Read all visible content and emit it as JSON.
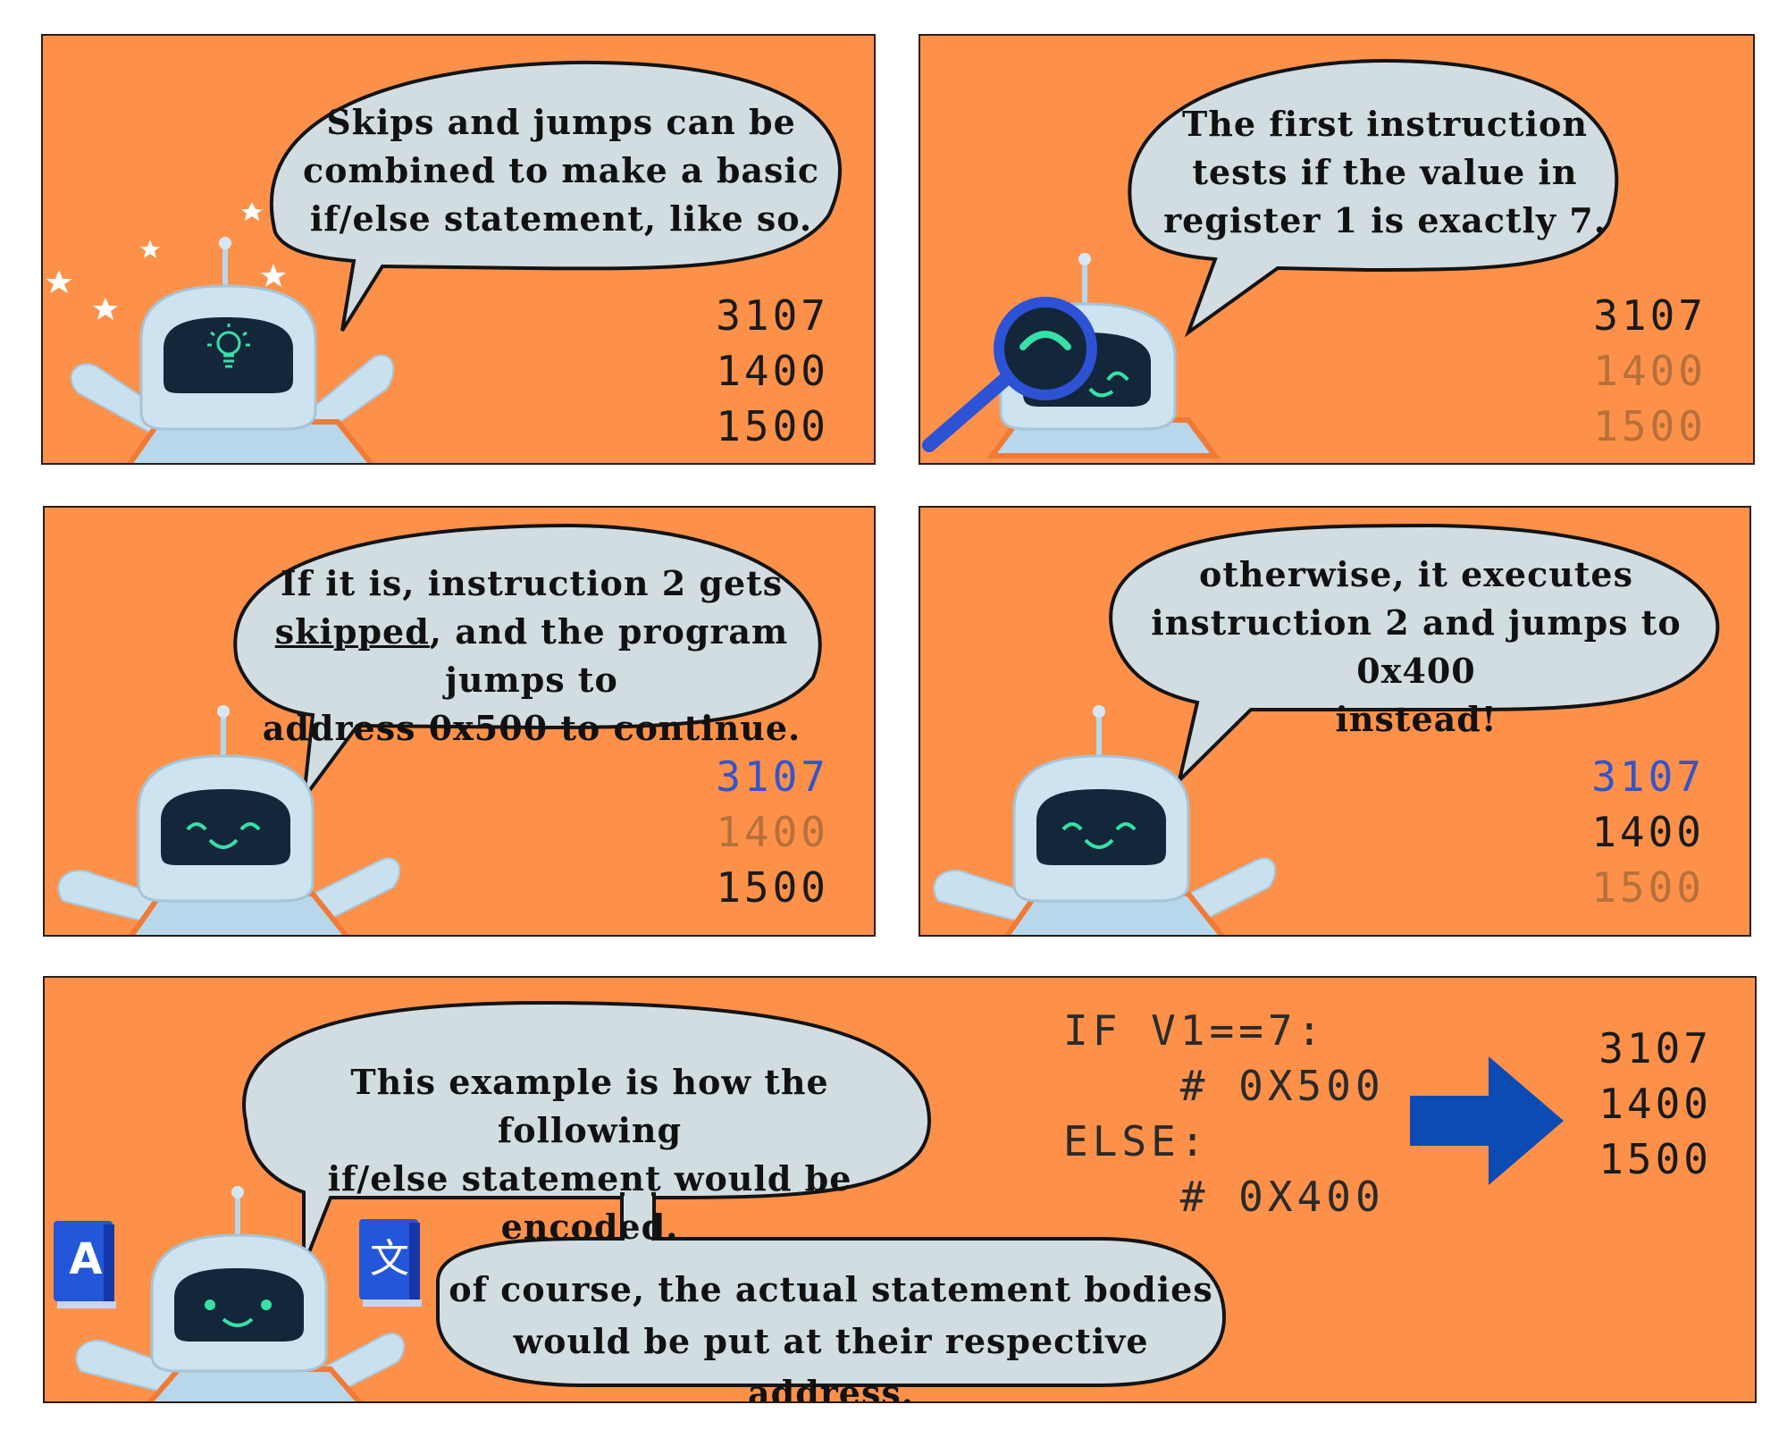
{
  "panels": [
    {
      "bubble_lines": [
        "Skips and jumps can be",
        "combined to make a basic",
        "if/else statement, like so."
      ],
      "code": [
        "3107",
        "1400",
        "1500"
      ],
      "code_styles": [
        "black",
        "black",
        "black"
      ]
    },
    {
      "bubble_lines": [
        "The first instruction",
        "tests if the value in",
        "register 1 is exactly 7."
      ],
      "code": [
        "3107",
        "1400",
        "1500"
      ],
      "code_styles": [
        "black",
        "faded",
        "faded"
      ]
    },
    {
      "bubble_pre": "If it is, instruction 2 gets",
      "bubble_skipped": "skipped",
      "bubble_mid": ", and the program jumps to",
      "bubble_last": "address 0x500 to continue.",
      "code": [
        "3107",
        "1400",
        "1500"
      ],
      "code_styles": [
        "blue",
        "faded",
        "black"
      ]
    },
    {
      "bubble_lines": [
        "otherwise, it executes",
        "instruction 2 and jumps to 0x400",
        "instead!"
      ],
      "code": [
        "3107",
        "1400",
        "1500"
      ],
      "code_styles": [
        "blue",
        "black",
        "faded"
      ]
    },
    {
      "bubble_lines": [
        "This example is how the following",
        "if/else statement would be encoded."
      ],
      "bubble2_lines": [
        "of course, the actual statement bodies",
        "would be put at their respective address."
      ],
      "pseudo": [
        "IF V1==7:",
        "    # 0X500",
        "ELSE:",
        "    # 0X400"
      ],
      "code": [
        "3107",
        "1400",
        "1500"
      ],
      "code_styles": [
        "black",
        "black",
        "black"
      ],
      "book_left_letter": "A",
      "book_right_letter": "文"
    }
  ],
  "colors": {
    "panel_bg": "#fd914a",
    "bubble": "#d2dde2",
    "robot_body": "#b9d7ea",
    "screen": "#13263a",
    "face": "#36e0a7",
    "blue_code": "#3455c9",
    "arrow": "#0b4bb3"
  },
  "icons": [
    "lightbulb-icon",
    "magnifier-icon",
    "star-icon",
    "book-icon",
    "arrow-right-icon"
  ]
}
